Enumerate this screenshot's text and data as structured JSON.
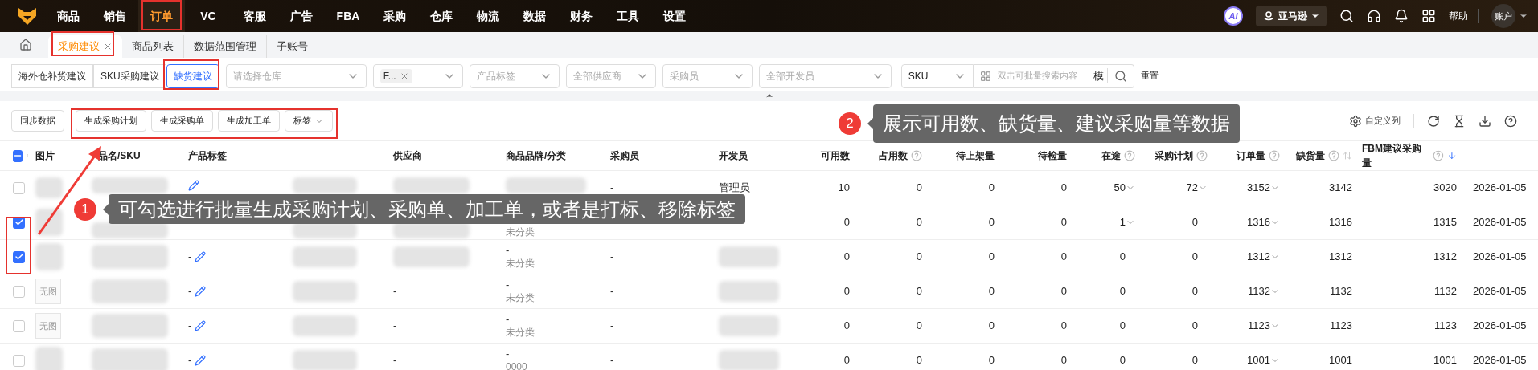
{
  "nav": {
    "items": [
      {
        "label": "商品",
        "selected": false
      },
      {
        "label": "销售",
        "selected": false
      },
      {
        "label": "订单",
        "selected": true
      },
      {
        "label": "VC",
        "selected": false
      },
      {
        "label": "客服",
        "selected": false
      },
      {
        "label": "广告",
        "selected": false
      },
      {
        "label": "FBA",
        "selected": false
      },
      {
        "label": "采购",
        "selected": false
      },
      {
        "label": "仓库",
        "selected": false
      },
      {
        "label": "物流",
        "selected": false
      },
      {
        "label": "数据",
        "selected": false
      },
      {
        "label": "财务",
        "selected": false
      },
      {
        "label": "工具",
        "selected": false
      },
      {
        "label": "设置",
        "selected": false
      }
    ],
    "ai": "AI",
    "marketplace": "亚马逊",
    "help": "帮助",
    "account": "账户"
  },
  "tabs": [
    {
      "label": "采购建议",
      "selected": true,
      "closable": true
    },
    {
      "label": "商品列表",
      "selected": false,
      "closable": false
    },
    {
      "label": "数据范围管理",
      "selected": false,
      "closable": false
    },
    {
      "label": "子账号",
      "selected": false,
      "closable": false
    }
  ],
  "filters": {
    "modes": [
      {
        "label": "海外仓补货建议",
        "selected": false
      },
      {
        "label": "SKU采购建议",
        "selected": false
      },
      {
        "label": "缺货建议",
        "selected": true
      }
    ],
    "selects": [
      {
        "placeholder": "请选择仓库"
      },
      {
        "chip": "F..."
      },
      {
        "placeholder": "产品标签"
      },
      {
        "placeholder": "全部供应商"
      },
      {
        "placeholder": "采购员"
      },
      {
        "placeholder": "全部开发员"
      }
    ],
    "search_type": "SKU",
    "search_placeholder": "双击可批量搜索内容",
    "match_mode": "模",
    "reset": "重置"
  },
  "toolbar": {
    "buttons": [
      "同步数据",
      "生成采购计划",
      "生成采购单",
      "生成加工单"
    ],
    "tag_menu": "标签",
    "custom_columns": "自定义列"
  },
  "table": {
    "select_all_indeterminate": true,
    "columns": [
      {
        "label": "图片"
      },
      {
        "label": "品名/SKU"
      },
      {
        "label": "产品标签"
      },
      {
        "label": "供应商"
      },
      {
        "label": "商品品牌/分类"
      },
      {
        "label": "采购员"
      },
      {
        "label": "开发员"
      },
      {
        "label": "可用数"
      },
      {
        "label": "占用数",
        "help": true
      },
      {
        "label": "待上架量"
      },
      {
        "label": "待检量"
      },
      {
        "label": "在途",
        "help": true
      },
      {
        "label": "采购计划",
        "help": true
      },
      {
        "label": "订单量",
        "help": true
      },
      {
        "label": "缺货量",
        "help": true,
        "sort_active": false
      },
      {
        "label": "FBM建议采购量",
        "help": true,
        "sort_active": true
      }
    ],
    "rows": [
      {
        "checked": false,
        "image": {
          "kind": "redacted"
        },
        "tag_edit": true,
        "supplier": {
          "kind": "redacted"
        },
        "brand": {
          "kind": "redacted"
        },
        "buyer": {
          "kind": "text",
          "text": "-"
        },
        "developer": {
          "kind": "text",
          "text": "管理员"
        },
        "available": "10",
        "occupied": "0",
        "pending_shelf": "0",
        "pending_check": "0",
        "in_transit": {
          "text": "50",
          "dropdown": true
        },
        "plan": {
          "text": "72",
          "dropdown": true
        },
        "orders": {
          "text": "3152",
          "dropdown": true
        },
        "shortage": "3142",
        "fbm": "3020",
        "date": "2026-01-05"
      },
      {
        "checked": true,
        "image": {
          "kind": "redacted"
        },
        "tag_edit": false,
        "supplier": {
          "kind": "redacted"
        },
        "brand": {
          "kind": "text",
          "category": "未分类"
        },
        "available": "0",
        "occupied": "0",
        "pending_shelf": "0",
        "pending_check": "0",
        "in_transit": {
          "text": "1",
          "dropdown": true
        },
        "plan": {
          "text": "0"
        },
        "orders": {
          "text": "1316",
          "dropdown": true
        },
        "shortage": "1316",
        "fbm": "1315",
        "date": "2026-01-05"
      },
      {
        "checked": true,
        "image": {
          "kind": "redacted"
        },
        "tag": "-",
        "tag_edit": true,
        "supplier": {
          "kind": "redacted"
        },
        "brand": {
          "kind": "text",
          "name": "-",
          "category": "未分类"
        },
        "buyer": {
          "kind": "text",
          "text": "-"
        },
        "developer": {
          "kind": "redacted"
        },
        "available": "0",
        "occupied": "0",
        "pending_shelf": "0",
        "pending_check": "0",
        "in_transit": {
          "text": "0"
        },
        "plan": {
          "text": "0"
        },
        "orders": {
          "text": "1312",
          "dropdown": true
        },
        "shortage": "1312",
        "fbm": "1312",
        "date": "2026-01-05"
      },
      {
        "checked": false,
        "image": {
          "kind": "placeholder",
          "text": "无图"
        },
        "tag": "-",
        "tag_edit": true,
        "supplier": {
          "kind": "text",
          "text": "-"
        },
        "brand": {
          "kind": "text",
          "name": "-",
          "category": "未分类"
        },
        "buyer": {
          "kind": "text",
          "text": "-"
        },
        "developer": {
          "kind": "redacted"
        },
        "available": "0",
        "occupied": "0",
        "pending_shelf": "0",
        "pending_check": "0",
        "in_transit": {
          "text": "0"
        },
        "plan": {
          "text": "0"
        },
        "orders": {
          "text": "1132",
          "dropdown": true
        },
        "shortage": "1132",
        "fbm": "1132",
        "date": "2026-01-05"
      },
      {
        "checked": false,
        "image": {
          "kind": "placeholder",
          "text": "无图"
        },
        "tag": "-",
        "tag_edit": true,
        "supplier": {
          "kind": "text",
          "text": "-"
        },
        "brand": {
          "kind": "text",
          "name": "-",
          "category": "未分类"
        },
        "buyer": {
          "kind": "text",
          "text": "-"
        },
        "developer": {
          "kind": "redacted"
        },
        "available": "0",
        "occupied": "0",
        "pending_shelf": "0",
        "pending_check": "0",
        "in_transit": {
          "text": "0"
        },
        "plan": {
          "text": "0"
        },
        "orders": {
          "text": "1123",
          "dropdown": true
        },
        "shortage": "1123",
        "fbm": "1123",
        "date": "2026-01-05"
      },
      {
        "checked": false,
        "image": {
          "kind": "redacted"
        },
        "tag": "-",
        "tag_edit": true,
        "supplier": {
          "kind": "text",
          "text": "-"
        },
        "brand": {
          "kind": "text",
          "name": "-",
          "category": "0000"
        },
        "buyer": {
          "kind": "text",
          "text": "-"
        },
        "developer": {
          "kind": "redacted"
        },
        "available": "0",
        "occupied": "0",
        "pending_shelf": "0",
        "pending_check": "0",
        "in_transit": {
          "text": "0"
        },
        "plan": {
          "text": "0"
        },
        "orders": {
          "text": "1001",
          "dropdown": true
        },
        "shortage": "1001",
        "fbm": "1001",
        "date": "2026-01-05"
      }
    ]
  },
  "annotations": [
    {
      "number": "1",
      "text": "可勾选进行批量生成采购计划、采购单、加工单，或者是打标、移除标签"
    },
    {
      "number": "2",
      "text": "展示可用数、缺货量、建议采购量等数据"
    }
  ]
}
